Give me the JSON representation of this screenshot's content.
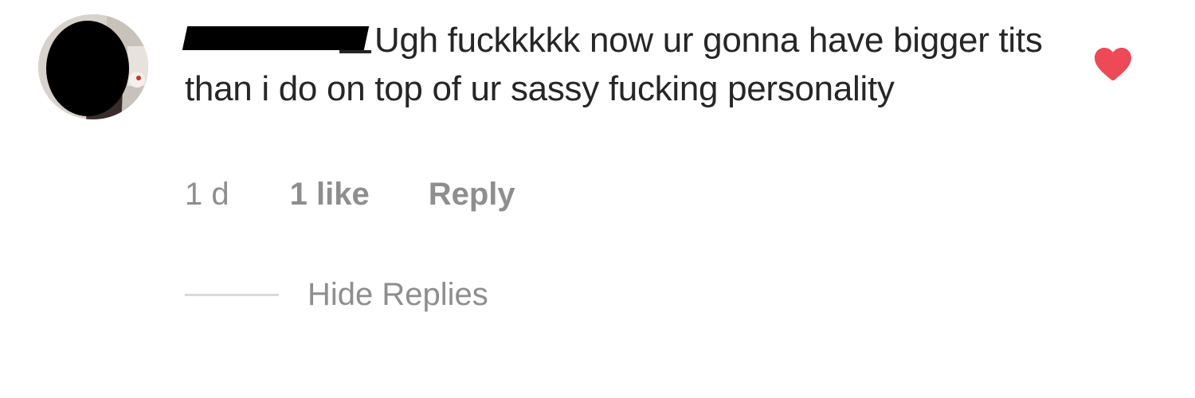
{
  "comment": {
    "text": "Ugh fuckkkkk now ur gonna have bigger tits than i do on top of ur sassy fucking personality",
    "time": "1 d",
    "likes": "1 like",
    "reply_label": "Reply",
    "liked": true
  },
  "replies": {
    "toggle_label": "Hide Replies"
  },
  "colors": {
    "heart": "#ed4956",
    "meta_text": "#8e8e8e",
    "body_text": "#262626",
    "divider": "#dbdbdb"
  },
  "icons": {
    "like": "heart-filled-icon"
  }
}
